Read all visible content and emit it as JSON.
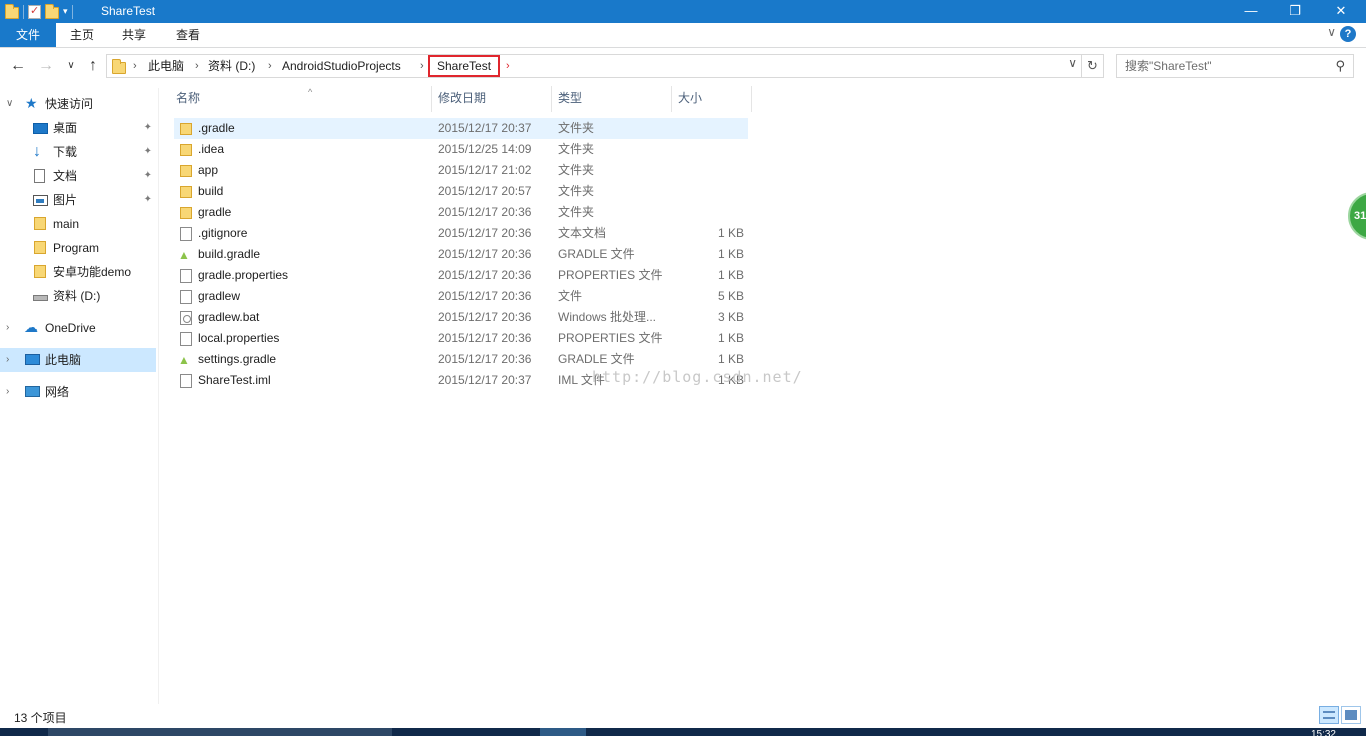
{
  "window": {
    "title": "ShareTest",
    "minimize": "—",
    "maximize": "❐",
    "close": "✕"
  },
  "ribbon": {
    "tabs": [
      "文件",
      "主页",
      "共享",
      "查看"
    ],
    "collapse": "∨",
    "help": "?"
  },
  "nav": {
    "back": "←",
    "forward": "→",
    "recent": "∨",
    "up": "↑",
    "breadcrumb": [
      "此电脑",
      "资料 (D:)",
      "AndroidStudioProjects",
      "ShareTest"
    ],
    "separator": "›",
    "dropdown": "∨",
    "refresh": "↻"
  },
  "search": {
    "placeholder": "搜索\"ShareTest\"",
    "icon": "⚲"
  },
  "sidebar": {
    "items": [
      {
        "label": "快速访问",
        "icon": "star-icon",
        "expander": "∨",
        "pinned": false
      },
      {
        "label": "桌面",
        "icon": "desktop-icon",
        "pinned": true
      },
      {
        "label": "下载",
        "icon": "download-icon",
        "pinned": true
      },
      {
        "label": "文档",
        "icon": "document-icon",
        "pinned": true
      },
      {
        "label": "图片",
        "icon": "pictures-icon",
        "pinned": true
      },
      {
        "label": "main",
        "icon": "folder-icon",
        "pinned": false
      },
      {
        "label": "Program",
        "icon": "folder-icon",
        "pinned": false
      },
      {
        "label": "安卓功能demo",
        "icon": "folder-icon",
        "pinned": false
      },
      {
        "label": "资料 (D:)",
        "icon": "drive-icon",
        "pinned": false
      },
      {
        "label": "OneDrive",
        "icon": "onedrive-icon",
        "expander": "›",
        "pinned": false
      },
      {
        "label": "此电脑",
        "icon": "this-pc-icon",
        "expander": "›",
        "pinned": false,
        "selected": true
      },
      {
        "label": "网络",
        "icon": "network-icon",
        "expander": "›",
        "pinned": false
      }
    ],
    "pin_glyph": "📌"
  },
  "columns": {
    "name": "名称",
    "date": "修改日期",
    "type": "类型",
    "size": "大小",
    "sort_indicator": "^"
  },
  "files": [
    {
      "name": ".gradle",
      "date": "2015/12/17 20:37",
      "type": "文件夹",
      "size": "",
      "icon": "folder-icon",
      "highlighted": true
    },
    {
      "name": ".idea",
      "date": "2015/12/25 14:09",
      "type": "文件夹",
      "size": "",
      "icon": "folder-icon"
    },
    {
      "name": "app",
      "date": "2015/12/17 21:02",
      "type": "文件夹",
      "size": "",
      "icon": "folder-icon"
    },
    {
      "name": "build",
      "date": "2015/12/17 20:57",
      "type": "文件夹",
      "size": "",
      "icon": "folder-icon"
    },
    {
      "name": "gradle",
      "date": "2015/12/17 20:36",
      "type": "文件夹",
      "size": "",
      "icon": "folder-icon"
    },
    {
      "name": ".gitignore",
      "date": "2015/12/17 20:36",
      "type": "文本文档",
      "size": "1 KB",
      "icon": "text-file-icon"
    },
    {
      "name": "build.gradle",
      "date": "2015/12/17 20:36",
      "type": "GRADLE 文件",
      "size": "1 KB",
      "icon": "android-icon"
    },
    {
      "name": "gradle.properties",
      "date": "2015/12/17 20:36",
      "type": "PROPERTIES 文件",
      "size": "1 KB",
      "icon": "file-icon"
    },
    {
      "name": "gradlew",
      "date": "2015/12/17 20:36",
      "type": "文件",
      "size": "5 KB",
      "icon": "file-icon"
    },
    {
      "name": "gradlew.bat",
      "date": "2015/12/17 20:36",
      "type": "Windows 批处理...",
      "size": "3 KB",
      "icon": "batch-file-icon"
    },
    {
      "name": "local.properties",
      "date": "2015/12/17 20:36",
      "type": "PROPERTIES 文件",
      "size": "1 KB",
      "icon": "file-icon"
    },
    {
      "name": "settings.gradle",
      "date": "2015/12/17 20:36",
      "type": "GRADLE 文件",
      "size": "1 KB",
      "icon": "android-icon"
    },
    {
      "name": "ShareTest.iml",
      "date": "2015/12/17 20:37",
      "type": "IML 文件",
      "size": "1 KB",
      "icon": "file-icon"
    }
  ],
  "watermark": "http://blog.csdn.net/",
  "badge": "31",
  "status": {
    "count": "13 个项目"
  },
  "taskbar": {
    "clock": "15:32"
  },
  "colors": {
    "accent": "#1979ca",
    "selection": "#cce8ff",
    "hover": "#e5f3ff",
    "highlight_border": "#e0262d"
  }
}
